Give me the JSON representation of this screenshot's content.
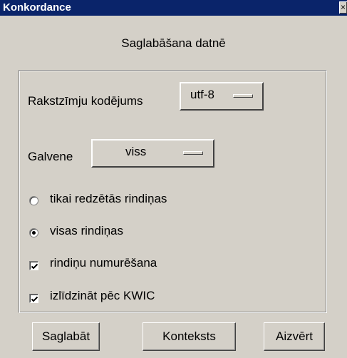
{
  "window": {
    "title": "Konkordance",
    "close_glyph": "×",
    "heading": "Saglabāšana datnē"
  },
  "encoding": {
    "label": "Rakstzīmju kodējums",
    "value": "utf-8"
  },
  "header_option": {
    "label": "Galvene",
    "value": "viss"
  },
  "rows_choice": {
    "options": [
      {
        "label": "tikai redzētās rindiņas",
        "selected": false
      },
      {
        "label": "visas rindiņas",
        "selected": true
      }
    ]
  },
  "checkboxes": [
    {
      "label": "rindiņu numurēšana",
      "checked": true
    },
    {
      "label": "izlīdzināt pēc KWIC",
      "checked": true
    }
  ],
  "buttons": {
    "save": "Saglabāt",
    "context": "Konteksts",
    "close": "Aizvērt"
  },
  "colors": {
    "titlebar": "#0a246a",
    "face": "#d4d0c8"
  }
}
